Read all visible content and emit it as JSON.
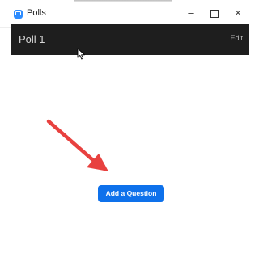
{
  "window": {
    "title": "Polls",
    "minimize_glyph": "–",
    "close_glyph": "×"
  },
  "header": {
    "poll_title": "Poll 1",
    "edit_label": "Edit"
  },
  "main": {
    "add_question_label": "Add a Question"
  },
  "icons": {
    "app": "polls-app-icon",
    "minimize": "minimize-icon",
    "maximize": "maximize-icon",
    "close": "close-icon",
    "cursor": "mouse-pointer-icon",
    "annotation": "red-arrow-icon"
  },
  "colors": {
    "header_bg": "#1e1e1e",
    "accent": "#0e71eb",
    "annotation_arrow": "#e8413f"
  }
}
